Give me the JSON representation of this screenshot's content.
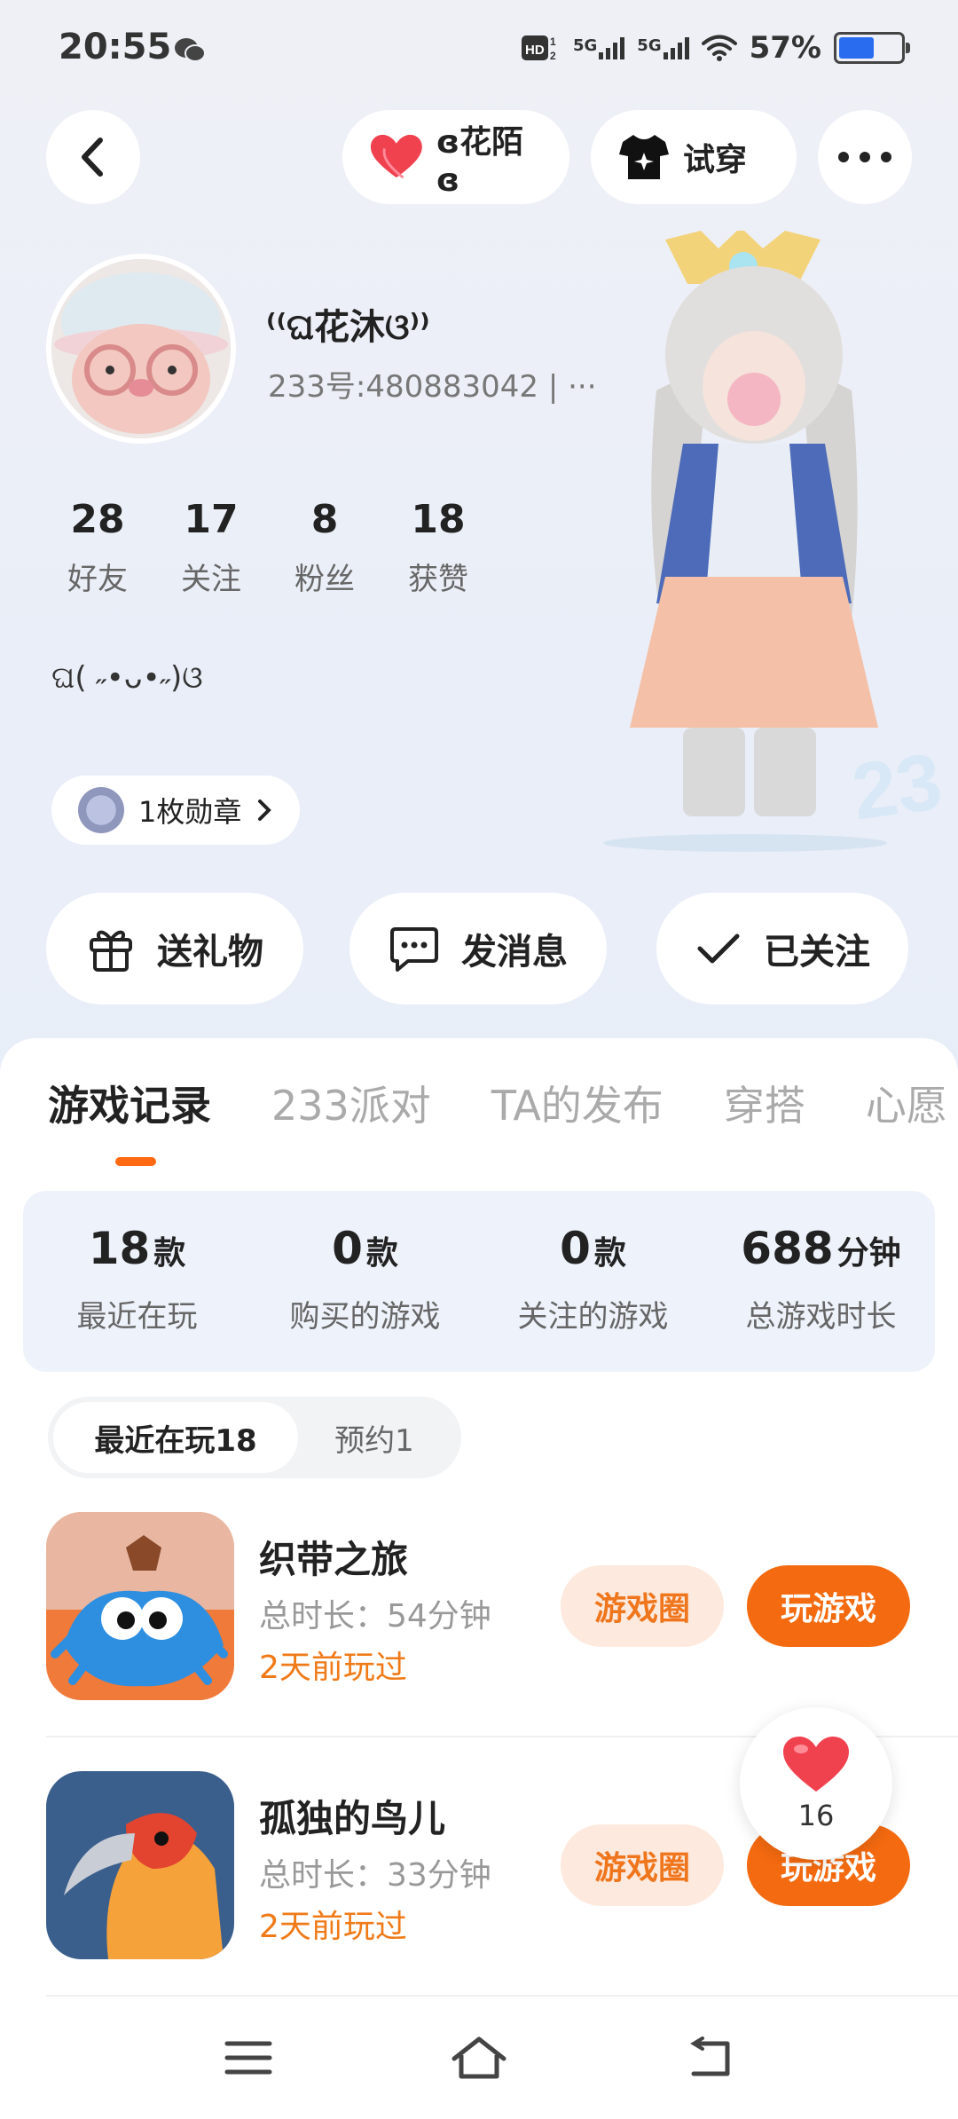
{
  "status_bar": {
    "time": "20:55",
    "network": "HD 5G 5G",
    "battery": "57%",
    "battery_level": 0.57
  },
  "header": {
    "back_icon": "chevron-left-icon",
    "couple_label": "ɞ花陌ɞ",
    "tryon_label": "试穿",
    "more_icon": "more-dots-icon"
  },
  "profile": {
    "nickname": "⁽⁽ଘ花沐ଓ⁾⁾",
    "uid": "233号:480883042 | ···",
    "stats": [
      {
        "num": "28",
        "label": "好友"
      },
      {
        "num": "17",
        "label": "关注"
      },
      {
        "num": "8",
        "label": "粉丝"
      },
      {
        "num": "18",
        "label": "获赞"
      }
    ],
    "bio": "ଘ( ˶•ᴗ•˶)ଓ",
    "medal_label": "1枚勋章"
  },
  "actions": {
    "gift": "送礼物",
    "message": "发消息",
    "follow": "已关注"
  },
  "tabs": [
    "游戏记录",
    "233派对",
    "TA的发布",
    "穿搭",
    "心愿"
  ],
  "summary": [
    {
      "value": "18",
      "unit": "款",
      "label": "最近在玩"
    },
    {
      "value": "0",
      "unit": "款",
      "label": "购买的游戏"
    },
    {
      "value": "0",
      "unit": "款",
      "label": "关注的游戏"
    },
    {
      "value": "688",
      "unit": "分钟",
      "label": "总游戏时长"
    }
  ],
  "segment": {
    "recent": "最近在玩18",
    "reserve": "预约1"
  },
  "games": [
    {
      "name": "织带之旅",
      "time": "总时长：54分钟",
      "last": "2天前玩过",
      "circle": "游戏圈",
      "play": "玩游戏"
    },
    {
      "name": "孤独的鸟儿",
      "time": "总时长：33分钟",
      "last": "2天前玩过",
      "circle": "游戏圈",
      "play": "玩游戏"
    }
  ],
  "like_count": "16",
  "colors": {
    "accent": "#f46a10",
    "accent_light": "#fde9dd",
    "like_red": "#f0414f"
  }
}
